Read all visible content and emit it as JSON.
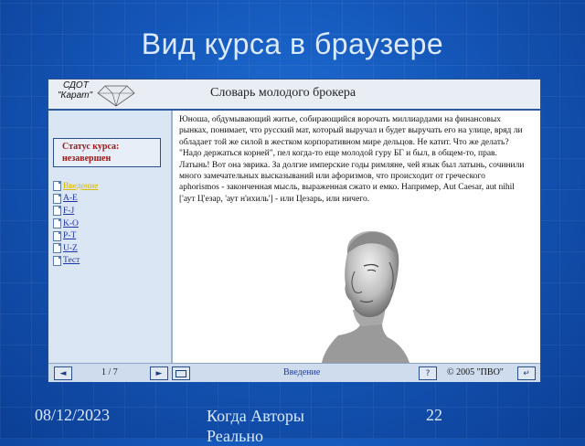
{
  "slide": {
    "title": "Вид курса в браузере",
    "footer_date": "08/12/2023",
    "footer_center": "Когда Авторы Реально",
    "page_number": "22"
  },
  "app": {
    "logo_line1": "СДОТ",
    "logo_line2": "\"Карат\"",
    "course_title": "Словарь молодого брокера"
  },
  "sidebar": {
    "status_label": "Статус курса:",
    "status_value": "незавершен",
    "items": [
      {
        "label": "Введение",
        "active": true
      },
      {
        "label": "А-Е"
      },
      {
        "label": "F-J"
      },
      {
        "label": "K-O"
      },
      {
        "label": "P-T"
      },
      {
        "label": "U-Z"
      },
      {
        "label": "Тест"
      }
    ]
  },
  "content": {
    "text": "Юноша, обдумывающий житье, собирающийся ворочать миллиардами на финансовых рынках, понимает, что русский мат, который выручал и будет выручать его на улице, вряд ли обладает той же силой в жестком корпоративном мире дельцов. Не катит. Что же делать? \"Надо держаться корней\", пел когда-то еще молодой гуру БГ и был, в общем-то, прав. Латынь! Вот она эврика. За долгие имперские годы римляне, чей язык был латынь, сочинили много замечательных высказываний или афоризмов, что происходит от греческого aphorismos - законченная мысль, выраженная сжато и емко. Например, Aut Caesar, aut nihil ['аут Ц'езар, 'аут н'ихиль'] - или Цезарь, или ничего.",
    "image": "caesar-bust"
  },
  "bottombar": {
    "prev_icon": "◄",
    "next_icon": "►",
    "pager": "1 / 7",
    "section": "Введение",
    "help_icon": "?",
    "copyright": "© 2005 \"ПВО\"",
    "exit_icon": "↵"
  },
  "colors": {
    "background": "#1456b8",
    "title": "#dce9ff",
    "status_text": "#a11717",
    "link": "#2233aa",
    "active_link": "#d8b900"
  }
}
